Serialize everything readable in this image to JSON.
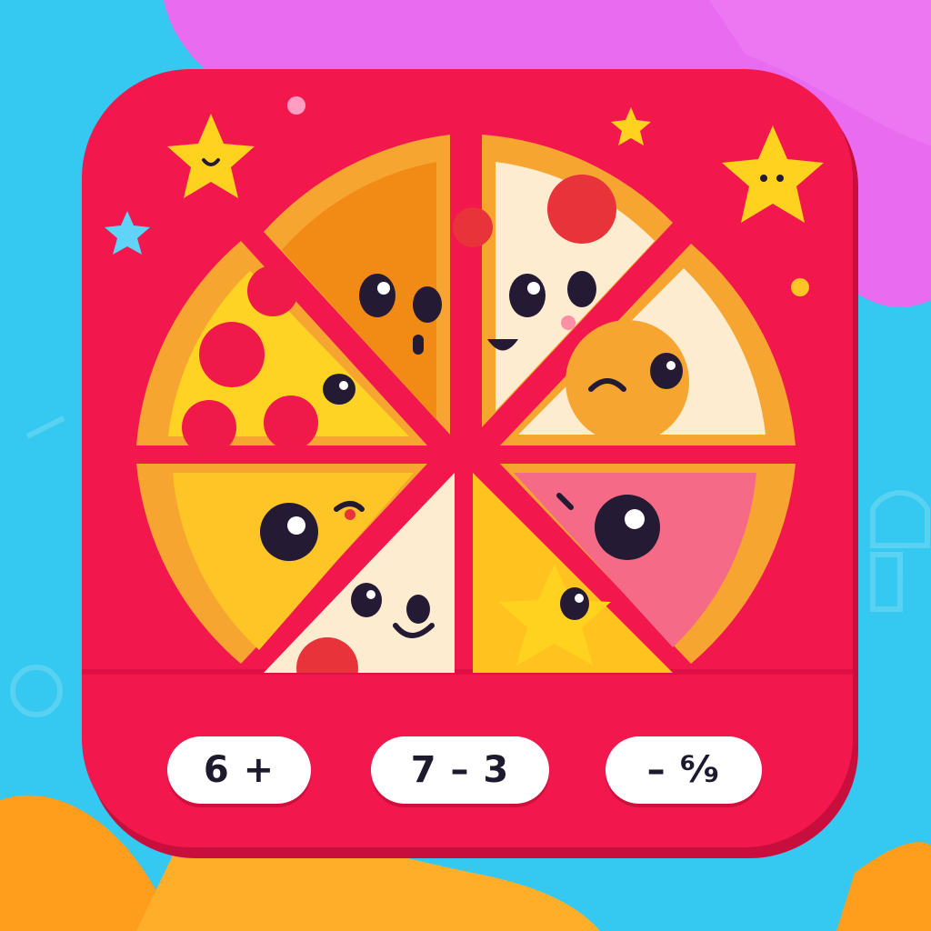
{
  "colors": {
    "tile": "#f2184e",
    "crust": "#f7a531",
    "sky": "#35c8f0",
    "pink_blob": "#e86bf0",
    "orange_blob": "#ff9d1c",
    "star": "#ffd21f"
  },
  "answers": [
    {
      "label": "6 +"
    },
    {
      "label": "7 – 3"
    },
    {
      "label": "– ⁶⁄₉"
    }
  ],
  "pizza": {
    "slice_count": 8,
    "slices": [
      {
        "topping": "cheese",
        "expression": "winking"
      },
      {
        "topping": "pepperoni",
        "expression": "smiling"
      },
      {
        "topping": "cheese",
        "expression": "calm"
      },
      {
        "topping": "ham",
        "expression": "surprised"
      },
      {
        "topping": "star",
        "expression": "cheerful"
      },
      {
        "topping": "cheese",
        "expression": "smiling"
      },
      {
        "topping": "cheese",
        "expression": "curious"
      },
      {
        "topping": "pepperoni",
        "expression": "curious"
      }
    ]
  },
  "decorations": [
    "star-icon",
    "star-icon",
    "star-icon",
    "star-icon",
    "sparkle-icon"
  ]
}
